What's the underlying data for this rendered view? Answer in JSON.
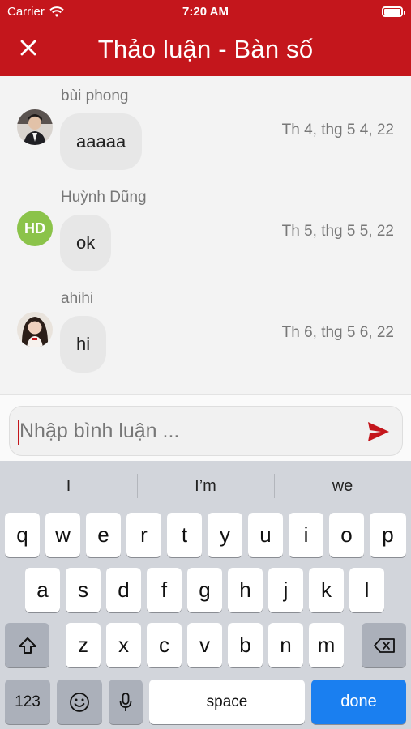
{
  "status_bar": {
    "carrier": "Carrier",
    "time": "7:20 AM"
  },
  "header": {
    "title": "Thảo luận - Bàn số",
    "close_icon": "close-icon"
  },
  "comments": [
    {
      "name": "bùi phong",
      "text": "aaaaa",
      "date": "Th 4, thg 5 4, 22",
      "avatar": "photo"
    },
    {
      "name": "Huỳnh Dũng",
      "text": "ok",
      "date": "Th 5, thg 5 5, 22",
      "avatar": "initials",
      "initials": "HD",
      "avatar_color": "#8bc34a"
    },
    {
      "name": "ahihi",
      "text": "hi",
      "date": "Th 6, thg 5 6, 22",
      "avatar": "photo"
    }
  ],
  "comment_input": {
    "placeholder": "Nhập bình luận ...",
    "value": ""
  },
  "keyboard": {
    "suggestions": [
      "I",
      "I’m",
      "we"
    ],
    "row1": [
      "q",
      "w",
      "e",
      "r",
      "t",
      "y",
      "u",
      "i",
      "o",
      "p"
    ],
    "row2": [
      "a",
      "s",
      "d",
      "f",
      "g",
      "h",
      "j",
      "k",
      "l"
    ],
    "row3": [
      "z",
      "x",
      "c",
      "v",
      "b",
      "n",
      "m"
    ],
    "numbers_label": "123",
    "space_label": "space",
    "done_label": "done"
  },
  "colors": {
    "primary": "#c4161c",
    "done_key": "#1a7ff0"
  }
}
